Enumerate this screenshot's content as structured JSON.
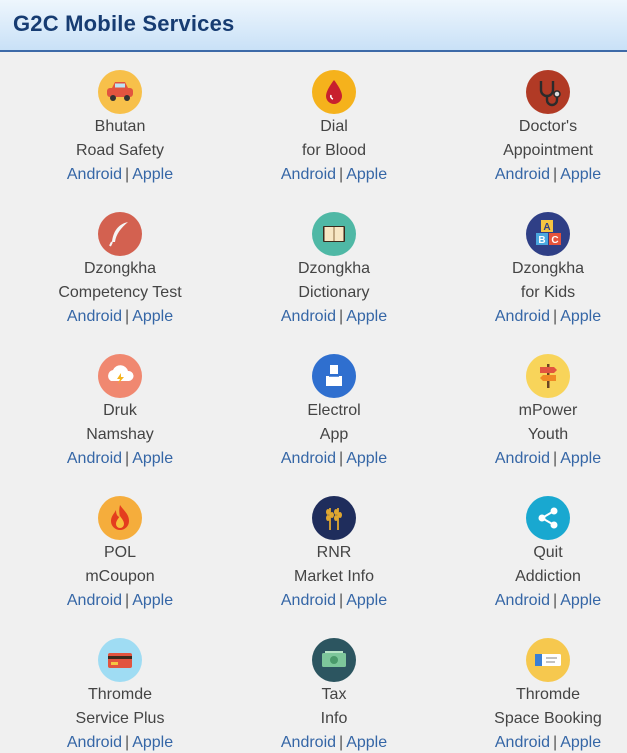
{
  "header": {
    "title": "G2C Mobile Services"
  },
  "link_separator": "|",
  "services": [
    {
      "line1": "Bhutan",
      "line2": "Road Safety",
      "icon": "car-icon",
      "color": "#f7c04a",
      "android": "Android",
      "apple": "Apple"
    },
    {
      "line1": "Dial",
      "line2": "for Blood",
      "icon": "blood-drop-icon",
      "color": "#f5b21c",
      "android": "Android",
      "apple": "Apple"
    },
    {
      "line1": "Doctor's",
      "line2": "Appointment",
      "icon": "stethoscope-icon",
      "color": "#b13a25",
      "android": "Android",
      "apple": "Apple"
    },
    {
      "line1": "Dzongkha",
      "line2": "Competency Test",
      "icon": "quill-icon",
      "color": "#d36150",
      "android": "Android",
      "apple": "Apple"
    },
    {
      "line1": "Dzongkha",
      "line2": "Dictionary",
      "icon": "book-icon",
      "color": "#4fb8a5",
      "android": "Android",
      "apple": "Apple"
    },
    {
      "line1": "Dzongkha",
      "line2": "for Kids",
      "icon": "abc-blocks-icon",
      "color": "#2f3f86",
      "android": "Android",
      "apple": "Apple"
    },
    {
      "line1": "Druk",
      "line2": "Namshay",
      "icon": "cloud-lightning-icon",
      "color": "#f08870",
      "android": "Android",
      "apple": "Apple"
    },
    {
      "line1": "Electrol",
      "line2": "App",
      "icon": "ballot-box-icon",
      "color": "#2f6fcf",
      "android": "Android",
      "apple": "Apple"
    },
    {
      "line1": "mPower",
      "line2": "Youth",
      "icon": "signpost-icon",
      "color": "#f8d45a",
      "android": "Android",
      "apple": "Apple"
    },
    {
      "line1": "POL",
      "line2": "mCoupon",
      "icon": "flame-icon",
      "color": "#f5ad3c",
      "android": "Android",
      "apple": "Apple"
    },
    {
      "line1": "RNR",
      "line2": "Market Info",
      "icon": "wheat-icon",
      "color": "#1f2d5c",
      "android": "Android",
      "apple": "Apple"
    },
    {
      "line1": "Quit",
      "line2": "Addiction",
      "icon": "share-icon",
      "color": "#19a8d0",
      "android": "Android",
      "apple": "Apple"
    },
    {
      "line1": "Thromde",
      "line2": "Service Plus",
      "icon": "credit-card-icon",
      "color": "#9fdcf3",
      "android": "Android",
      "apple": "Apple"
    },
    {
      "line1": "Tax",
      "line2": "Info",
      "icon": "money-icon",
      "color": "#2c5560",
      "android": "Android",
      "apple": "Apple"
    },
    {
      "line1": "Thromde",
      "line2": "Space Booking",
      "icon": "ticket-icon",
      "color": "#f6c84e",
      "android": "Android",
      "apple": "Apple"
    }
  ]
}
